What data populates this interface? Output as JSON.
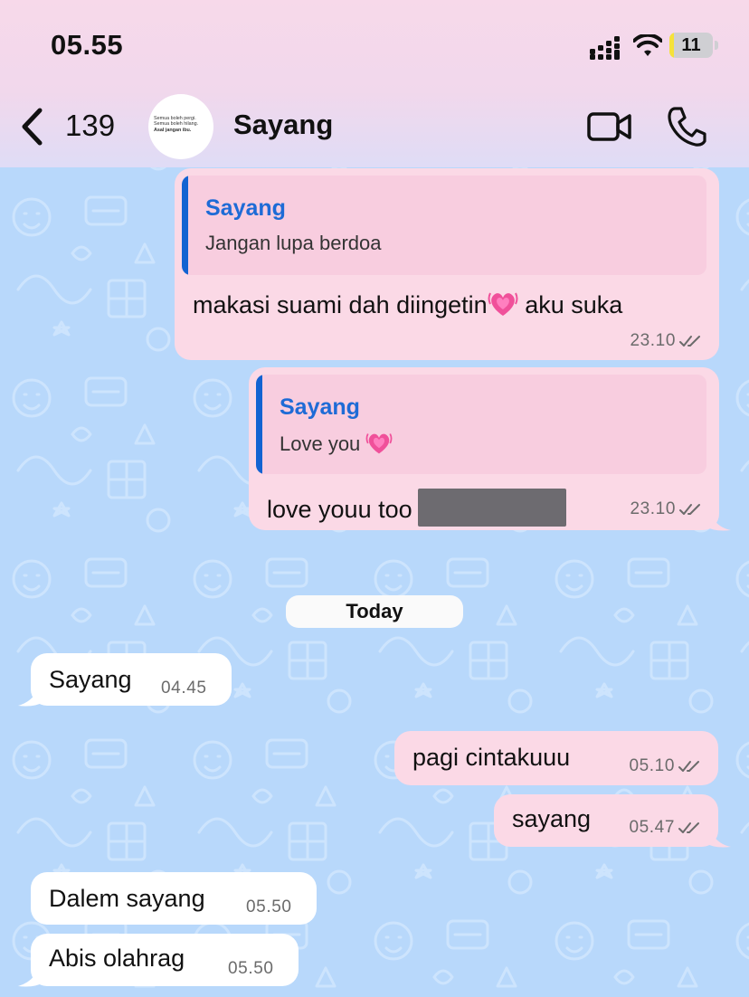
{
  "status_bar": {
    "time": "05.55",
    "battery_level": "11"
  },
  "header": {
    "back_count": "139",
    "contact_name": "Sayang",
    "avatar_text": [
      "Semua boleh pergi.",
      "Semua boleh hilang.",
      "Asal jangan ibu."
    ]
  },
  "messages": [
    {
      "direction": "outgoing",
      "reply_to": {
        "name": "Sayang",
        "text": "Jangan lupa berdoa"
      },
      "text": "makasi suami dah diingetin",
      "text_after_emoji": " aku suka",
      "emoji": "growing-heart",
      "time": "23.10",
      "status": "read"
    },
    {
      "direction": "outgoing",
      "reply_to": {
        "name": "Sayang",
        "text": "Love you"
      },
      "text": "love youu too",
      "redacted": true,
      "time": "23.10",
      "status": "read"
    },
    {
      "direction": "incoming",
      "text": "Sayang",
      "time": "04.45"
    },
    {
      "direction": "outgoing",
      "text": "pagi cintakuuu",
      "time": "05.10",
      "status": "read"
    },
    {
      "direction": "outgoing",
      "text": "sayang",
      "time": "05.47",
      "status": "read"
    },
    {
      "direction": "incoming",
      "text": "Dalem sayang",
      "time": "05.50"
    },
    {
      "direction": "incoming",
      "text": "Abis olahrag",
      "time": "05.50"
    }
  ],
  "date_separator": "Today",
  "colors": {
    "outgoing_bubble": "#fbd9e6",
    "incoming_bubble": "#ffffff",
    "quote_bg": "#f8cddf",
    "quote_name": "#1e6bd6",
    "wallpaper": "#b8d8fb",
    "header_gradient": [
      "#f7d9ea",
      "#dfdcf6"
    ]
  }
}
